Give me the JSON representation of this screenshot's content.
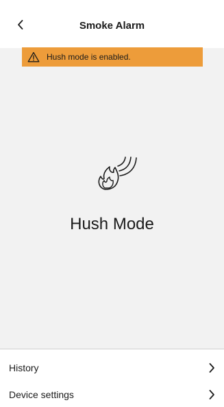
{
  "header": {
    "title": "Smoke Alarm",
    "back_icon": "chevron-left-icon"
  },
  "banner": {
    "text": "Hush mode is enabled.",
    "icon": "warning-triangle-icon",
    "color": "#ed9c3a"
  },
  "status": {
    "label": "Hush Mode",
    "icon": "flame-hush-icon"
  },
  "menu": [
    {
      "label": "History",
      "icon": "chevron-right-icon"
    },
    {
      "label": "Device settings",
      "icon": "chevron-right-icon"
    }
  ]
}
